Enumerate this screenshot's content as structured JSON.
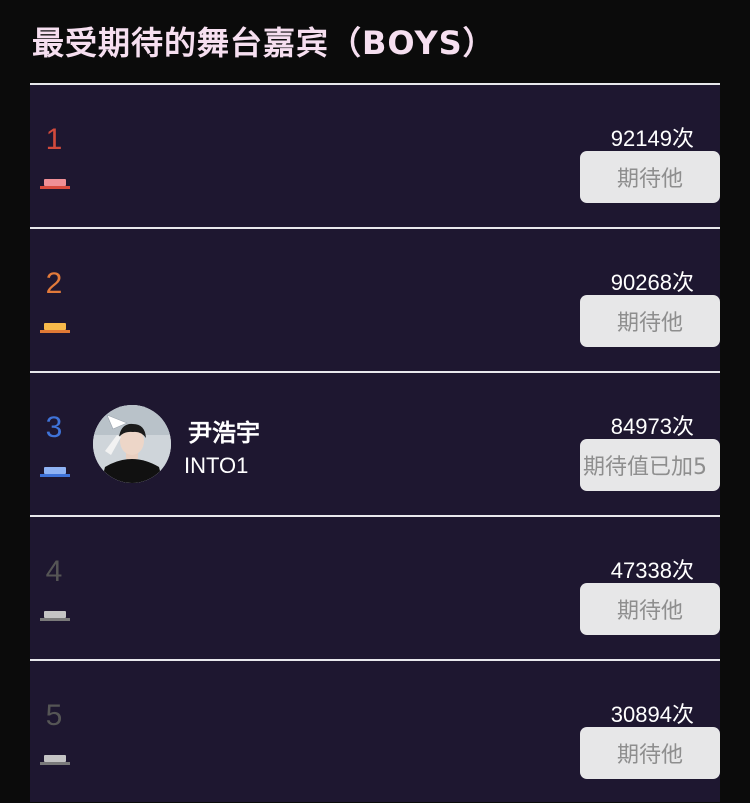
{
  "page": {
    "title": "最受期待的舞台嘉宾（BOYS）"
  },
  "ranking": [
    {
      "rank": "1",
      "count": "92149",
      "unit": "次",
      "button": "期待他",
      "name": "",
      "group": "",
      "rank_color": "#d24a3c",
      "bar_color": "#f08f96",
      "base_color": "#d94b3f"
    },
    {
      "rank": "2",
      "count": "90268",
      "unit": "次",
      "button": "期待他",
      "name": "",
      "group": "",
      "rank_color": "#e27a3a",
      "bar_color": "#f6b94a",
      "base_color": "#e07a35"
    },
    {
      "rank": "3",
      "count": "84973",
      "unit": "次",
      "button": "期待值已加5",
      "name": "尹浩宇",
      "group": "INTO1",
      "rank_color": "#3f73d8",
      "bar_color": "#8fb3f4",
      "base_color": "#3f73d8"
    },
    {
      "rank": "4",
      "count": "47338",
      "unit": "次",
      "button": "期待他",
      "name": "",
      "group": "",
      "rank_color": "#555555",
      "bar_color": "#c4c4c4",
      "base_color": "#7a7a7a"
    },
    {
      "rank": "5",
      "count": "30894",
      "unit": "次",
      "button": "期待他",
      "name": "",
      "group": "",
      "rank_color": "#555555",
      "bar_color": "#c4c4c4",
      "base_color": "#7a7a7a"
    }
  ]
}
